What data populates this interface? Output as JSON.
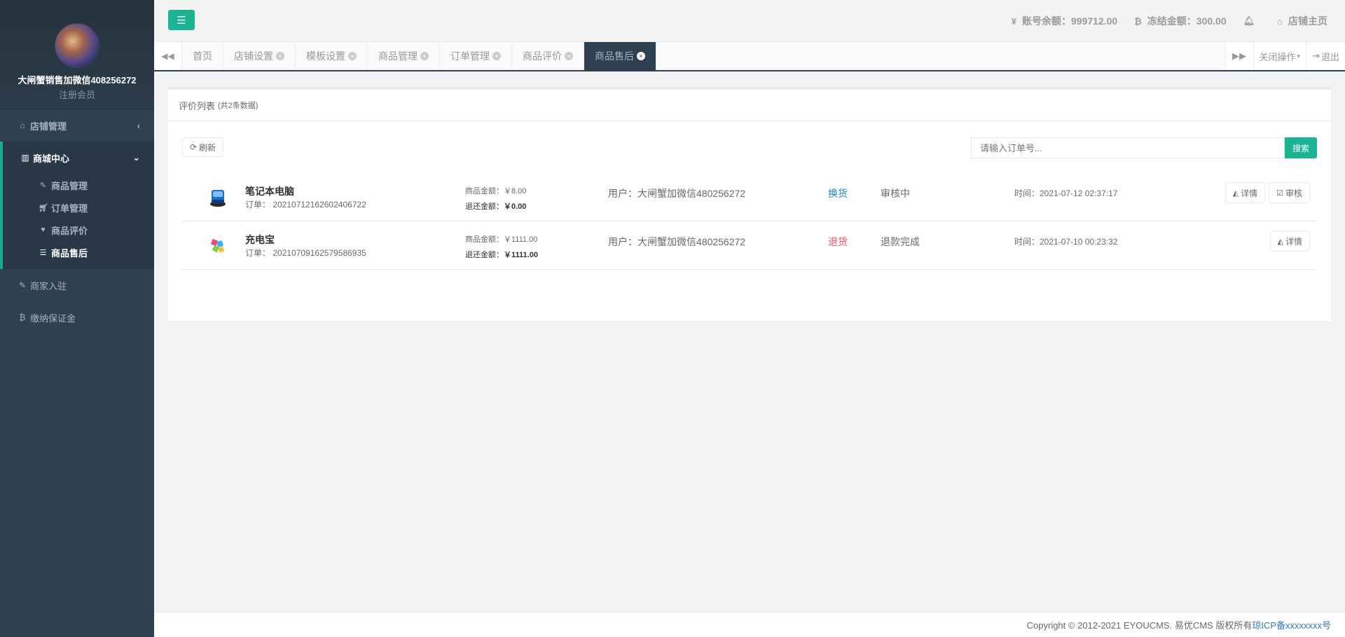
{
  "sidebar": {
    "username": "大闸蟹销售加微信408256272",
    "role": "注册会员",
    "items": [
      {
        "label": "店铺管理",
        "icon": "home-icon"
      },
      {
        "label": "商城中心",
        "icon": "bar-chart-icon"
      },
      {
        "label": "商家入驻",
        "icon": "edit-icon"
      },
      {
        "label": "缴纳保证金",
        "icon": "bitcoin-icon"
      }
    ],
    "sub_items": [
      {
        "label": "商品管理",
        "icon": "edit-square-icon"
      },
      {
        "label": "订单管理",
        "icon": "cart-icon"
      },
      {
        "label": "商品评价",
        "icon": "heart-icon"
      },
      {
        "label": "商品售后",
        "icon": "database-icon"
      }
    ]
  },
  "topbar": {
    "balance": "账号余额：999712.00",
    "frozen": "冻结金额：300.00",
    "shop_home": "店铺主页"
  },
  "tabs": [
    {
      "label": "首页"
    },
    {
      "label": "店铺设置"
    },
    {
      "label": "模板设置"
    },
    {
      "label": "商品管理"
    },
    {
      "label": "订单管理"
    },
    {
      "label": "商品评价"
    },
    {
      "label": "商品售后"
    }
  ],
  "tab_actions": {
    "close_ops": "关闭操作",
    "logout": "退出"
  },
  "panel": {
    "title": "评价列表",
    "count": "(共2条数据)",
    "refresh": "刷新",
    "search_placeholder": "请输入订单号...",
    "search_btn": "搜索"
  },
  "rows": [
    {
      "name": "笔记本电脑",
      "order": "订单：  20210712162602406722",
      "amount": "商品金额：￥8.00",
      "refund_label": "退还金额：",
      "refund_value": "￥0.00",
      "user": "用户：大闸蟹加微信480256272",
      "type": "换货",
      "status": "审核中",
      "time": "时间：2021-07-12 02:37:17",
      "detail": "详情",
      "review": "审核"
    },
    {
      "name": "充电宝",
      "order": "订单：  20210709162579586935",
      "amount": "商品金额：￥1111.00",
      "refund_label": "退还金额：",
      "refund_value": "￥1111.00",
      "user": "用户：大闸蟹加微信480256272",
      "type": "退货",
      "status": "退款完成",
      "time": "时间：2021-07-10 00:23:32",
      "detail": "详情"
    }
  ],
  "footer": {
    "copyright": "Copyright © 2012-2021 EYOUCMS. 易优CMS 版权所有 ",
    "icp": "琼ICP备xxxxxxxx号"
  },
  "colors": {
    "sidebar_bg": "#2f4050",
    "accent": "#1ab394",
    "exchange": "#1c84c6",
    "return": "#ed5565"
  }
}
